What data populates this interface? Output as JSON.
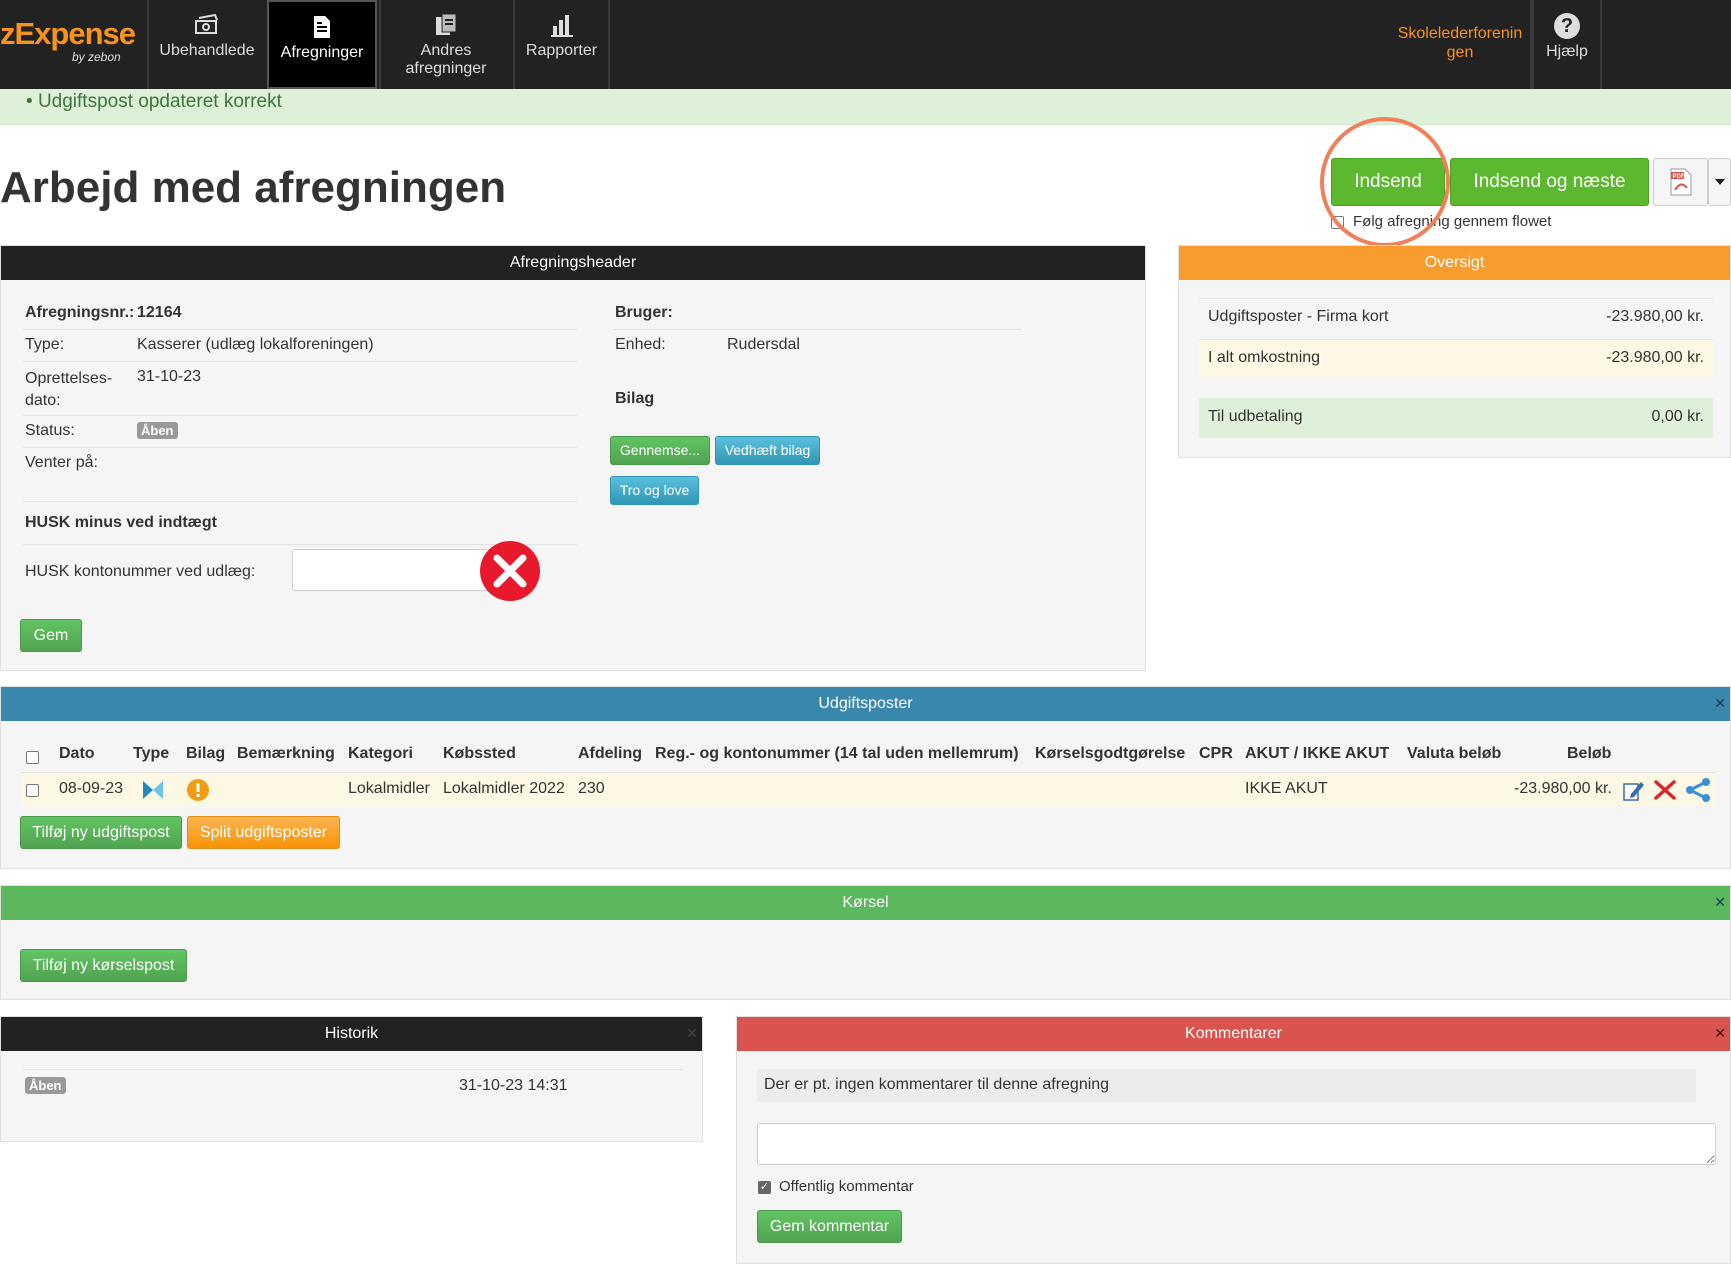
{
  "nav": {
    "logo_text": "zExpense",
    "logo_by": "by zebon",
    "items": [
      {
        "label": "Ubehandlede"
      },
      {
        "label": "Afregninger"
      },
      {
        "label": "Andres afregninger"
      },
      {
        "label": "Rapporter"
      }
    ],
    "org_name": "Skolelederforeningen",
    "help_label": "Hjælp"
  },
  "alert": {
    "message": "Udgiftspost opdateret korrekt"
  },
  "page": {
    "title": "Arbejd med afregningen"
  },
  "actions": {
    "submit_label": "Indsend",
    "submit_next_label": "Indsend og næste",
    "follow_flow_label": "Følg afregning gennem flowet"
  },
  "header_panel": {
    "title": "Afregningsheader",
    "settlement_no_label": "Afregningsnr.:",
    "settlement_no": "12164",
    "type_label": "Type:",
    "type_value": "Kasserer (udlæg lokalforeningen)",
    "created_label": "Oprettelses-dato:",
    "created_value": "31-10-23",
    "status_label": "Status:",
    "status_value": "Åben",
    "waiting_label": "Venter på:",
    "user_label": "Bruger:",
    "unit_label": "Enhed:",
    "unit_value": "Rudersdal",
    "bilag_title": "Bilag",
    "browse_label": "Gennemse...",
    "attach_label": "Vedhæft bilag",
    "tro_label": "Tro og love",
    "husk_title": "HUSK minus ved indtægt",
    "account_label": "HUSK kontonummer ved udlæg:",
    "account_value": "",
    "save_label": "Gem"
  },
  "overview": {
    "title": "Oversigt",
    "rows": [
      {
        "label": "Udgiftsposter - Firma kort",
        "value": "-23.980,00 kr."
      },
      {
        "label": "I alt omkostning",
        "value": "-23.980,00 kr."
      },
      {
        "label": "Til udbetaling",
        "value": "0,00 kr."
      }
    ]
  },
  "expenses": {
    "title": "Udgiftsposter",
    "columns": [
      "Dato",
      "Type",
      "Bilag",
      "Bemærkning",
      "Kategori",
      "Købssted",
      "Afdeling",
      "Reg.- og kontonummer (14 tal uden mellemrum)",
      "Kørselsgodtgørelse",
      "CPR",
      "AKUT / IKKE AKUT",
      "Valuta beløb",
      "Beløb"
    ],
    "row": {
      "date": "08-09-23",
      "category": "Lokalmidler",
      "place": "Lokalmidler 2022",
      "department": "230",
      "urgency": "IKKE AKUT",
      "amount": "-23.980,00 kr."
    },
    "add_label": "Tilføj ny udgiftspost",
    "split_label": "Split udgiftsposter"
  },
  "driving": {
    "title": "Kørsel",
    "add_label": "Tilføj ny kørselspost"
  },
  "history": {
    "title": "Historik",
    "status": "Åben",
    "timestamp": "31-10-23 14:31"
  },
  "comments": {
    "title": "Kommentarer",
    "empty_text": "Der er pt. ingen kommentarer til denne afregning",
    "public_label": "Offentlig kommentar",
    "save_label": "Gem kommentar"
  }
}
